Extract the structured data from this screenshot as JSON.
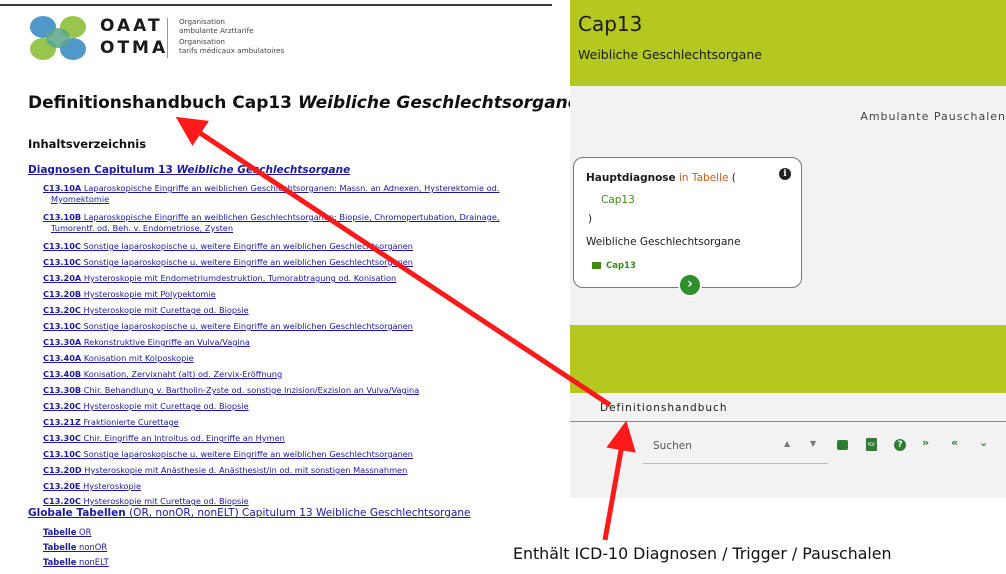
{
  "document": {
    "logo": {
      "abbr_line1": "OAAT",
      "abbr_line2": "OTMA",
      "org_line1": "Organisation",
      "org_line2": "ambulante Arzttarife",
      "org_line3": "Organisation",
      "org_line4": "tarifs médicaux ambulatoires"
    },
    "title_plain": "Definitionshandbuch Cap13 ",
    "title_italic": "Weibliche Geschlechtsorgane",
    "toc_heading": "Inhaltsverzeichnis",
    "diagnosen_link": {
      "prefix": "Diagnosen Capitulum 13 ",
      "italic": "Weibliche Geschlechtsorgane"
    },
    "toc_items": [
      {
        "code": "C13.10A",
        "text": " Laparoskopische Eingriffe an weiblichen Geschlechtsorganen: Massn. an Adnexen, Hysterektomie od.",
        "text2": "Myomektomie"
      },
      {
        "code": "C13.10B",
        "text": " Laparoskopische Eingriffe an weiblichen Geschlechtsorganen: Biopsie, Chromopertubation, Drainage,",
        "text2": "Tumorentf. od. Beh. v. Endometriose, Zysten"
      },
      {
        "code": "C13.10C",
        "text": " Sonstige laparoskopische u. weitere Eingriffe an weiblichen Geschlechtsorganen",
        "text2": ""
      },
      {
        "code": "C13.10C",
        "text": " Sonstige laparoskopische u. weitere Eingriffe an weiblichen Geschlechtsorganen",
        "text2": ""
      },
      {
        "code": "C13.20A",
        "text": " Hysteroskopie mit Endometriumdestruktion, Tumorabtragung od. Konisation",
        "text2": ""
      },
      {
        "code": "C13.20B",
        "text": " Hysteroskopie mit Polypektomie",
        "text2": ""
      },
      {
        "code": "C13.20C",
        "text": " Hysteroskopie mit Curettage od. Biopsie",
        "text2": ""
      },
      {
        "code": "C13.10C",
        "text": " Sonstige laparoskopische u. weitere Eingriffe an weiblichen Geschlechtsorganen",
        "text2": ""
      },
      {
        "code": "C13.30A",
        "text": " Rekonstruktive Eingriffe an Vulva/Vagina",
        "text2": ""
      },
      {
        "code": "C13.40A",
        "text": " Konisation mit Kolposkopie",
        "text2": ""
      },
      {
        "code": "C13.40B",
        "text": " Konisation, Zervixnaht (alt) od. Zervix-Eröffnung",
        "text2": ""
      },
      {
        "code": "C13.30B",
        "text": " Chir. Behandlung v. Bartholin-Zyste od. sonstige Inzision/Exzision an Vulva/Vagina",
        "text2": ""
      },
      {
        "code": "C13.20C",
        "text": " Hysteroskopie mit Curettage od. Biopsie",
        "text2": ""
      },
      {
        "code": "C13.21Z",
        "text": " Fraktionierte Curettage",
        "text2": ""
      },
      {
        "code": "C13.30C",
        "text": " Chir. Eingriffe an Introitus od. Eingriffe an Hymen",
        "text2": ""
      },
      {
        "code": "C13.10C",
        "text": " Sonstige laparoskopische u. weitere Eingriffe an weiblichen Geschlechtsorganen",
        "text2": ""
      },
      {
        "code": "C13.20D",
        "text": " Hysteroskopie mit Anästhesie d. Anästhesist/in od. mit sonstigen Massnahmen",
        "text2": ""
      },
      {
        "code": "C13.20E",
        "text": " Hysteroskopie",
        "text2": ""
      },
      {
        "code": "C13.20C",
        "text": " Hysteroskopie mit Curettage od. Biopsie",
        "text2": ""
      }
    ],
    "globale_link": {
      "bold": "Globale Tabellen",
      "rest": " (OR, nonOR, nonELT) Capitulum 13 Weibliche Geschlechtsorgane"
    },
    "tables": [
      {
        "bold": "Tabelle",
        "rest": " OR"
      },
      {
        "bold": "Tabelle",
        "rest": " nonOR"
      },
      {
        "bold": "Tabelle",
        "rest": " nonELT"
      }
    ]
  },
  "app": {
    "header_title": "Cap13",
    "header_subtitle": "Weibliche Geschlechtsorgane",
    "section_label": "Ambulante Pauschalen",
    "card": {
      "title_bold": "Hauptdiagnose",
      "title_keyword": " in Tabelle",
      "title_paren": " (",
      "cap_value": "Cap13",
      "close_paren": ")",
      "description": "Weibliche Geschlechtsorgane",
      "link_label": "Cap13",
      "info_icon": "info-icon",
      "go_icon": "chevron-right-icon"
    },
    "definitions_label": "Definitionshandbuch",
    "search_placeholder": "Suchen",
    "toolbar_icons": [
      "triangle-up-icon",
      "triangle-down-icon",
      "print-icon",
      "pdf-icon",
      "help-icon",
      "double-chevron-down-icon",
      "double-chevron-up-icon",
      "chevron-down-icon"
    ],
    "colors": {
      "header": "#b5c81f",
      "accent_green": "#2e7d32",
      "keyword_orange": "#c65f1d",
      "arrow_red": "#ff1a1a"
    }
  },
  "annotation_caption": "Enthält ICD-10 Diagnosen / Trigger / Pauschalen"
}
